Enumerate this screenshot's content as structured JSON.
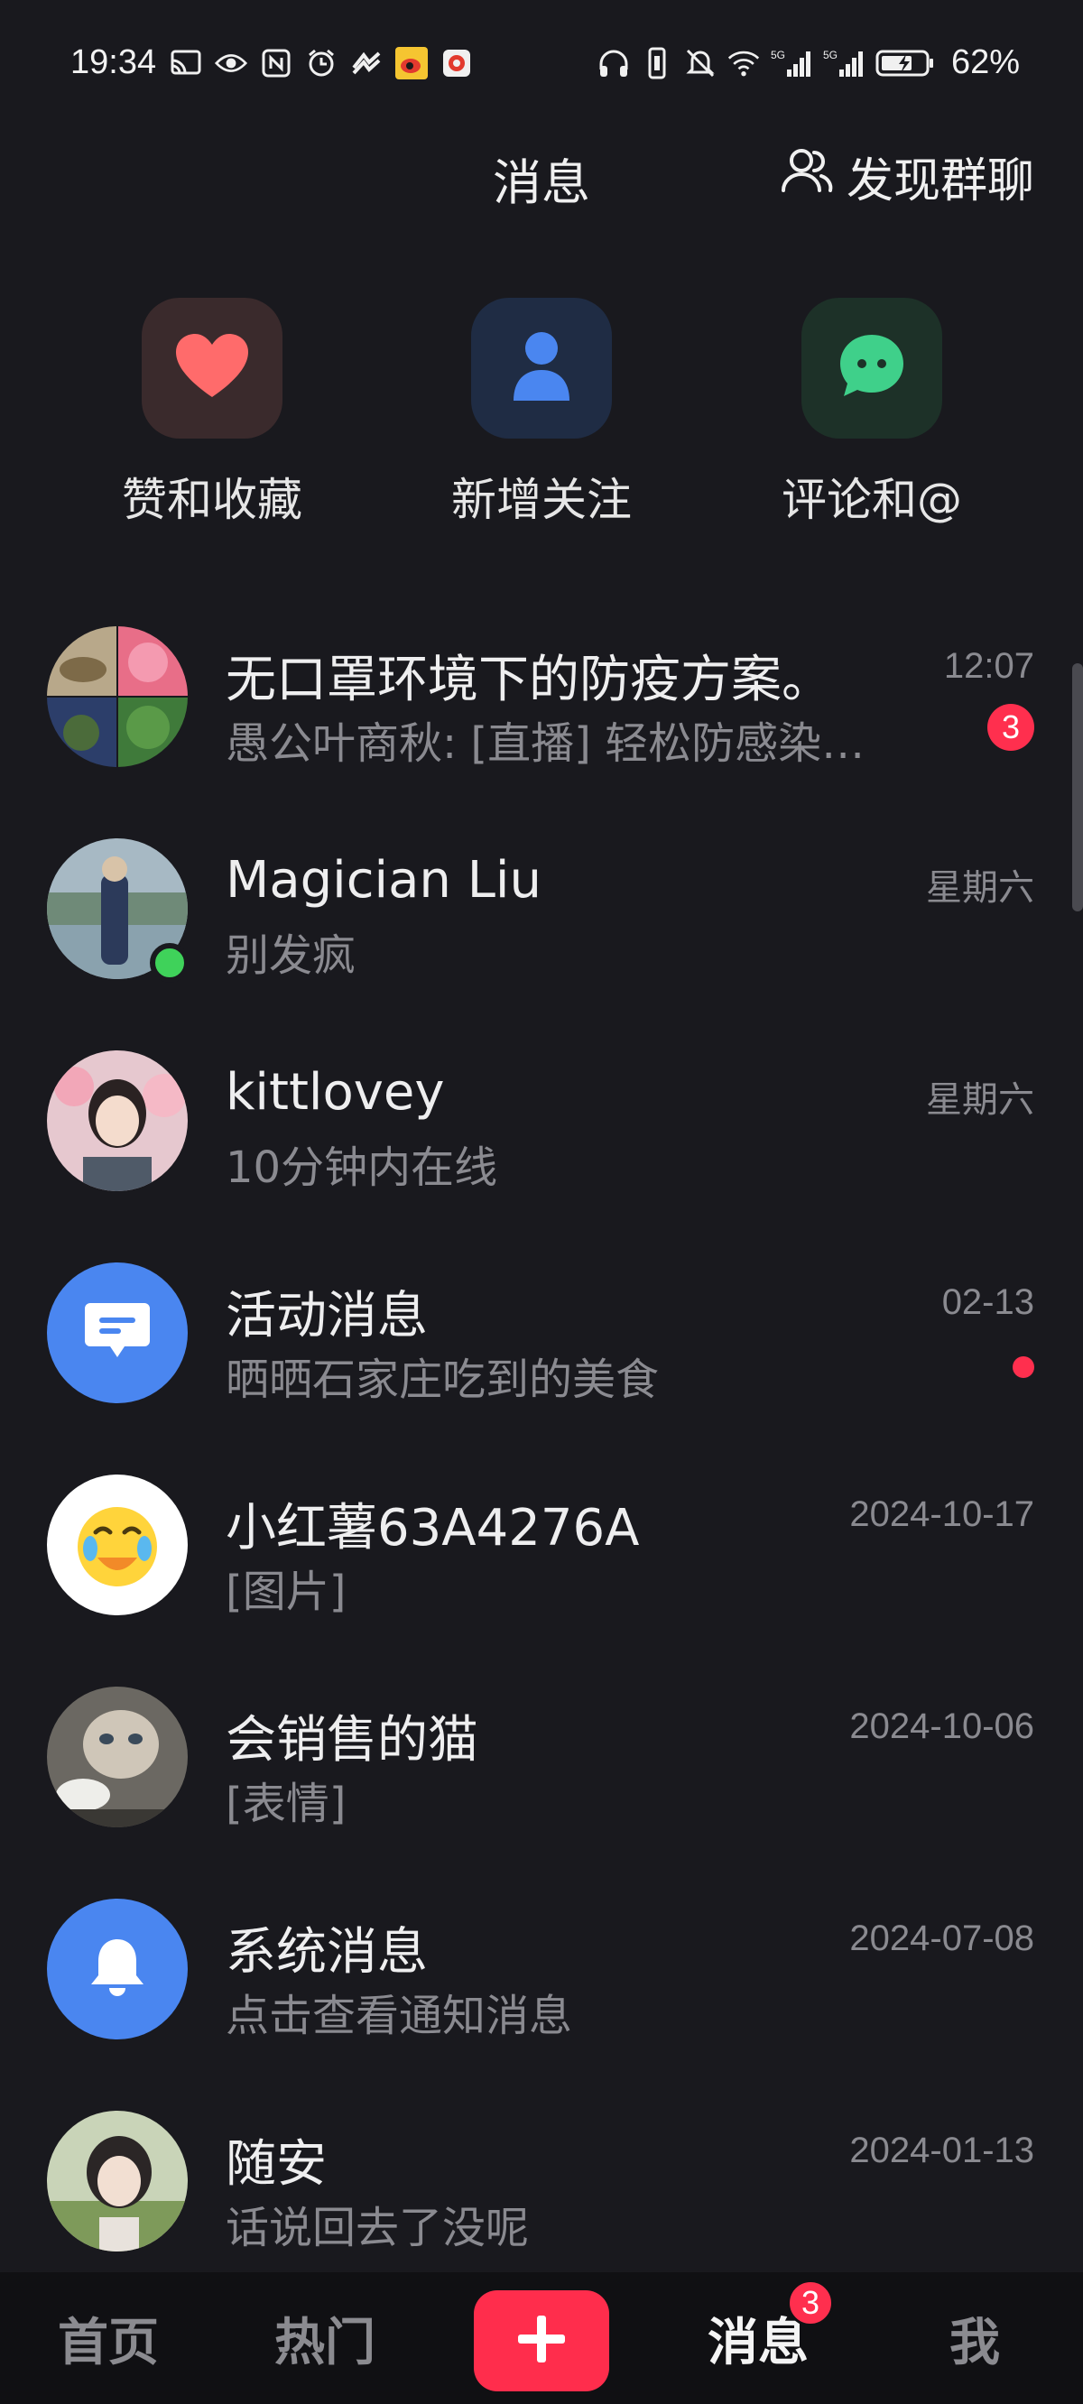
{
  "status_bar": {
    "time": "19:34",
    "battery": "62%",
    "left_icons": [
      "cast-icon",
      "eye-icon",
      "nfc-icon",
      "alarm-icon",
      "app-icon",
      "weibo-icon",
      "app-icon"
    ],
    "right_icons": [
      "headphones-icon",
      "vibrate-icon",
      "mute-icon",
      "wifi-icon",
      "signal-5g-icon",
      "signal-5g-icon",
      "battery-icon"
    ]
  },
  "header": {
    "title": "消息",
    "discover_label": "发现群聊",
    "discover_icon": "users-icon"
  },
  "quick_actions": [
    {
      "label": "赞和收藏",
      "icon": "heart-icon",
      "color": "#ff6b6b"
    },
    {
      "label": "新增关注",
      "icon": "person-icon",
      "color": "#4a86f0"
    },
    {
      "label": "评论和@",
      "icon": "chat-bubble-icon",
      "color": "#3fd08a"
    }
  ],
  "conversations": [
    {
      "name": "无口罩环境下的防疫方案。",
      "preview": "愚公叶商秋: [直播] 轻松防感染…",
      "time": "12:07",
      "unread": "3"
    },
    {
      "name": "Magician Liu",
      "preview": "别发疯",
      "time": "星期六",
      "online": true
    },
    {
      "name": "kittlovey",
      "preview": "10分钟内在线",
      "time": "星期六"
    },
    {
      "name": "活动消息",
      "preview": "晒晒石家庄吃到的美食",
      "time": "02-13",
      "dot": true
    },
    {
      "name": "小红薯63A4276A",
      "preview": "[图片]",
      "time": "2024-10-17"
    },
    {
      "name": "会销售的猫",
      "preview": "[表情]",
      "time": "2024-10-06"
    },
    {
      "name": "系统消息",
      "preview": "点击查看通知消息",
      "time": "2024-07-08"
    },
    {
      "name": "随安",
      "preview": "话说回去了没呢",
      "time": "2024-01-13"
    }
  ],
  "tab_bar": {
    "home": "首页",
    "hot": "热门",
    "post_icon": "plus-icon",
    "messages": "消息",
    "messages_badge": "3",
    "me": "我"
  },
  "colors": {
    "background": "#19191e",
    "accent": "#ff2d4c",
    "blue": "#4a86f0",
    "online": "#3fd25a"
  }
}
